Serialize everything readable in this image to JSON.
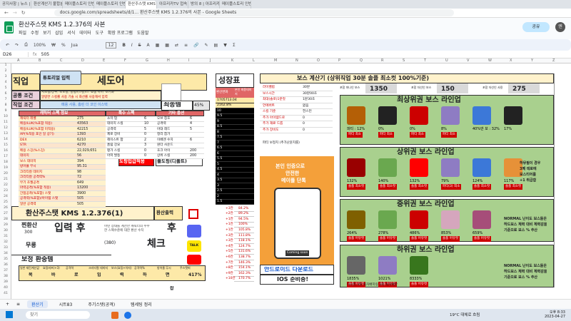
{
  "browser": {
    "tabs": [
      "공지사항 | 뉴스 | 메이플스",
      "환산계산기 불합분: 네이버",
      "메이플스토리 인벤 : 스탯환",
      "메이플스토리 인벤 : 환산 주",
      "환산주스탯 KMS 1.2.376의",
      "아프리카TV 접속",
      "방의 8 | 아프리카TV 플레이",
      "메이플스토리 인벤 자유게시"
    ],
    "url": "docs.google.com/spreadsheets/d/1... 환산주스탯 KMS 1.2.376의 사본 - Google Sheets"
  },
  "doc": {
    "title": "환산주스탯 KMS 1.2.376의 사본",
    "menus": [
      "파일",
      "수정",
      "보기",
      "삽입",
      "서식",
      "데이터",
      "도구",
      "확장 프로그램",
      "도움말"
    ],
    "share_label": "공유",
    "avatar_letter": "엔"
  },
  "toolbar": {
    "zoom": "100%",
    "font": "Jua",
    "size": "12"
  },
  "formula": {
    "cell": "D26",
    "value": "505"
  },
  "columns": [
    "A",
    "B",
    "C",
    "D",
    "E",
    "F",
    "G",
    "H",
    "I",
    "J",
    "K",
    "L",
    "M",
    "N",
    "O",
    "P",
    "Q",
    "R",
    "S",
    "T",
    "U",
    "V",
    "W",
    "X",
    "Y",
    "Z"
  ],
  "rows": [
    "1",
    "2",
    "3",
    "4",
    "5",
    "6",
    "7",
    "8",
    "9",
    "10",
    "11",
    "12",
    "13",
    "14",
    "15",
    "16",
    "17",
    "18",
    "19",
    "20",
    "21",
    "22",
    "23",
    "24",
    "25",
    "26",
    "27",
    "28",
    "29",
    "30",
    "31",
    "32",
    "33",
    "34",
    "35",
    "36",
    "37",
    "38",
    "39",
    "40",
    "41"
  ],
  "left": {
    "job_label": "직업",
    "job_value": "세도어",
    "tutorial": "튜토리얼 입력",
    "common_label": "공통 조건",
    "job_cond_label": "직업 조건",
    "note1": "지도링/상투, 도도링, 풍링/(스킬)스: 쇼룸'이미' 조기와",
    "note2": "알랑한 스킬롤 사용 기술 시 화산롤 사용해서 입력",
    "note3": "메용 사용, 홈린 더 코인 이스택",
    "max_level": "최종템",
    "max_pct": "45%",
    "stats_header": "캐릭터 스펙 정보",
    "stats": [
      [
        "캐릭터 레벨",
        "275"
      ],
      [
        "메용/LUK(%포함 적용)",
        "43563"
      ],
      [
        "메용/LUK(%포함 미적용)",
        "42215"
      ],
      [
        "AP(%적용 포인 일 상기)",
        "1393"
      ],
      [
        "DEX",
        "6210"
      ],
      [
        "STR",
        "4270"
      ],
      [
        "메용 스깅(%스깅)",
        "22,029,651"
      ],
      [
        "데미지",
        "56"
      ],
      [
        "보스 데미지",
        "394"
      ],
      [
        "방어율 무시",
        "95.31"
      ],
      [
        "크리티컬 데미지",
        "98"
      ],
      [
        "크리티컬 공격력%",
        "72"
      ],
      [
        "무기 초월공격",
        "649"
      ],
      [
        "마력공격(%포함 적용)",
        "13200"
      ],
      [
        "간접공격(%포함) 스탯",
        "3900"
      ],
      [
        "공격력(%포함)/아이템 스탯",
        "505"
      ],
      [
        "일반 공격력",
        "505"
      ]
    ],
    "special_header": "특수 스펙",
    "special": [
      [
        "소이 업",
        "6"
      ],
      [
        "데미지 스킬",
        "10"
      ],
      [
        "공격력",
        "5"
      ],
      [
        "제로 장비",
        "0"
      ],
      [
        "헤이스트 합",
        "2"
      ],
      [
        "홈림 강요",
        "3"
      ],
      [
        "평가 스킬",
        "0"
      ],
      [
        "아저 발동",
        "0"
      ]
    ],
    "other_header": "기타 옵션",
    "other": [
      [
        "오브 칭호",
        "6"
      ],
      [
        "공격력",
        "4"
      ],
      [
        "아대 레드",
        "5"
      ],
      [
        "정리 참가",
        ""
      ],
      [
        "이베엔 수치",
        "6"
      ],
      [
        "원더 사운드",
        ""
      ],
      [
        "호크 아이",
        "200"
      ],
      [
        "상위 스킬",
        "200"
      ]
    ],
    "tag_dodging": "도핑입급적용",
    "tag_plain": "풀도핑(디폴트)",
    "title_banner": "환산주스탯 KMS 1.2.376(1)",
    "output_label": "환산출력",
    "sim_label": "찐환산",
    "sim_value": "300",
    "input_after": "입력 후",
    "input_after2": "후",
    "bottom_note": "어떤 상태를 계산한 캐릭터의 수수한 스펙수준에 대한 환산 수치",
    "bottom_val": "(380)",
    "check_text": "체크",
    "free_label": "무릉",
    "correction_label": "보정 환중템",
    "table_headers": [
      "일반 재진계산값",
      "효팅버프(+3)",
      "공격력",
      "크리티컬 데미지",
      "보스(효팅+아자)",
      "공격력%",
      "방어율 무시",
      "주스탯퍼"
    ],
    "table_sub": [
      "목",
      "바",
      "로",
      "입",
      "력",
      "하",
      "면",
      "417%"
    ],
    "final_char": "잡"
  },
  "growth": {
    "title": "성장표",
    "col1": "환산변화",
    "col2": "본인 최종데미지",
    "vals": [
      "1705713.04",
      "2162.8%",
      "10",
      "9.5",
      "9",
      "8.5",
      "8",
      "7.5",
      "7",
      "6.5",
      "6",
      "5.5",
      "5",
      "4.5",
      "4",
      "3.5",
      "3",
      "2.5",
      "2",
      "1.5"
    ],
    "pct": [
      [
        "+3칸",
        "84.2%"
      ],
      [
        "+2칸",
        "89.2%"
      ],
      [
        "+1칸",
        "94.5%"
      ],
      [
        "+1칸",
        "100%"
      ],
      [
        "+1칸",
        "105.8%"
      ],
      [
        "+3칸",
        "111.8%"
      ],
      [
        "+3칸",
        "118.1%"
      ],
      [
        "+4칸",
        "124.7%"
      ],
      [
        "+5칸",
        "131.6%"
      ],
      [
        "+6칸",
        "138.7%"
      ],
      [
        "+7칸",
        "146.3%"
      ],
      [
        "+8칸",
        "154.1%"
      ],
      [
        "+9칸",
        "162.3%"
      ],
      [
        "+10칸",
        "170.7%"
      ]
    ]
  },
  "boss": {
    "header": "보스 계산기 (상위직업 30분 솔플 최소컷 100%기준)",
    "labels": [
      [
        "라이벨럽",
        "30분"
      ],
      [
        "보스시간",
        "30분00초"
      ],
      [
        "최대(솔로)1분컷",
        "1분30초"
      ],
      [
        "언에버트",
        "없음"
      ],
      [
        "스킬 기준",
        "헌스턴"
      ],
      [
        "추가 아이템드로",
        "0"
      ],
      [
        "추가 재료 드롭",
        "0"
      ],
      [
        "추가 장비도",
        "0"
      ]
    ],
    "lvl_text": "파티 보정치 (추가난뮨치를)",
    "stats": [
      [
        "1350"
      ],
      [
        "150"
      ],
      [
        "275"
      ]
    ],
    "stat_labels": [
      "포함 마나인 보스",
      "포함 자선인 보스",
      "포함 자선인 사용"
    ],
    "sections": [
      "최상위권 보스 라인업",
      "상위권 보스 라인업",
      "중위권 보스 라인업",
      "하위권 보스 라인업"
    ],
    "top_pcts": [
      "파티 : 12%",
      "0%",
      "0%",
      "8%",
      "40%만 보 : 32%",
      "17%"
    ],
    "top_tags": [
      "파티 최소",
      "파티 최소",
      "파티 최소",
      "파티 최소"
    ],
    "up_pcts": [
      "132%",
      "140%",
      "132%",
      "79%",
      "124%",
      "117%"
    ],
    "up_tags": [
      "솔플 최소컷",
      "솔플 최소컷",
      "솔플 최소컷",
      "파티(3) 최소",
      "솔플 최소컷",
      "솔플 최소컷"
    ],
    "up_note": [
      "하뮤필이 경우",
      "3페 테로에",
      "보스티어를",
      "+1 취급함"
    ],
    "mid_pcts": [
      "264%",
      "278%",
      "486%",
      "853%",
      "659%"
    ],
    "mid_tags": [
      "솔플 어유컷",
      "솔플 어유컷",
      "솔플 어유컷",
      "솔플 어유컷",
      "솔플 어유컷"
    ],
    "mid_note": [
      "NORMAL 난이도 보스들은",
      "하드보스 체력 대비 체력감을",
      "기준으로 보스 % 추산"
    ],
    "low_pcts": [
      "1835%",
      "1021%",
      "8333%"
    ],
    "low_tags": [
      "솔플 어유컷",
      "솔플 어유컷",
      "솔플 어유컷"
    ],
    "low_note": [
      "NORMAL 난이도 보스들은",
      "하드보스 체력 대비 체력감을",
      "기준으로 보스 % 추산"
    ],
    "low_text": "하시된 3회 독차배히링 3회 독차배만"
  },
  "ad": {
    "top1": "본인 인증으로",
    "top2": "안전한",
    "top3": "메이플 단톡",
    "android": "안드로이드 다운로드",
    "ios": "IOS 준비중!",
    "coming": "Coming soon"
  },
  "sheets": [
    "환산기",
    "시트83",
    "주기스탯(공격)",
    "템세팅 정리"
  ],
  "taskbar": {
    "search": "찾기",
    "weather": "19°C 대체로 흐림",
    "time": "오후 8:33",
    "date": "2023-04-27"
  },
  "colors": {
    "accent": "#0b57d0",
    "banner_yellow": "#ffd966",
    "boss_green": "#a9d08e",
    "job_purple": "#b4a7d6",
    "ad_orange": "#f4a03a"
  }
}
